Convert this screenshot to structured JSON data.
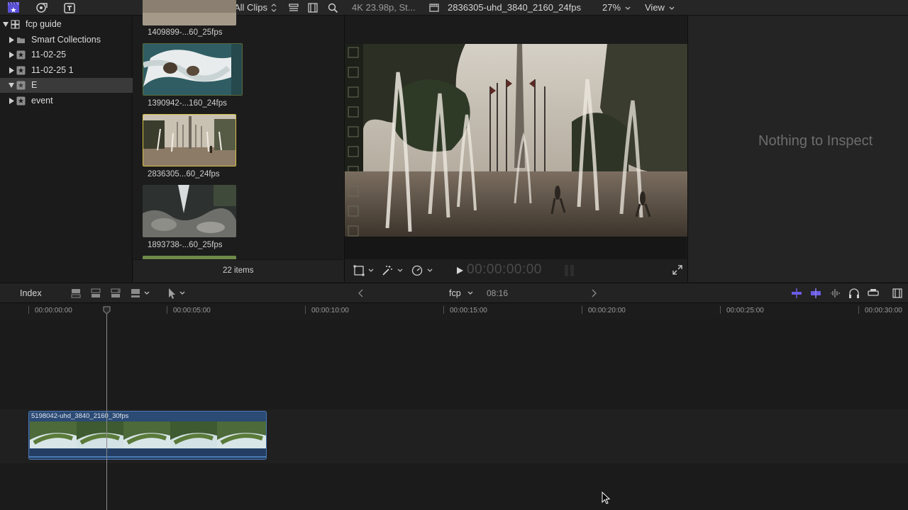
{
  "toolbar": {
    "browser_filter": "All Clips",
    "format_info": "4K 23.98p, St...",
    "clip_title": "2836305-uhd_3840_2160_24fps",
    "zoom": "27%",
    "view_menu": "View"
  },
  "sidebar": {
    "library": "fcp guide",
    "items": [
      {
        "label": "Smart Collections",
        "icon": "folder-icon"
      },
      {
        "label": "11-02-25",
        "icon": "event-star-icon"
      },
      {
        "label": "11-02-25 1",
        "icon": "event-star-icon"
      },
      {
        "label": "E",
        "icon": "event-star-icon",
        "selected": true
      },
      {
        "label": "event",
        "icon": "event-star-icon"
      }
    ]
  },
  "browser": {
    "clips": [
      {
        "name": "1409899-...60_25fps"
      },
      {
        "name": "1390942-...160_24fps"
      },
      {
        "name": "2836305...60_24fps",
        "selected": true
      },
      {
        "name": "1893738-...60_25fps"
      }
    ],
    "item_count": "22 items"
  },
  "viewer": {
    "timecode": "00:00:00:00"
  },
  "inspector": {
    "empty_text": "Nothing to Inspect"
  },
  "timeline": {
    "index_label": "Index",
    "project_name": "fcp",
    "duration": "08:16",
    "ruler": [
      "00:00:00:00",
      "00:00:05:00",
      "00:00:10:00",
      "00:00:15:00",
      "00:00:20:00",
      "00:00:25:00",
      "00:00:30:00"
    ],
    "clip_name": "5198042-uhd_3840_2160_30fps"
  },
  "colors": {
    "accent_purple": "#6b5ce7",
    "clip_blue": "#2b4a74",
    "selection_yellow": "#d6c24a"
  }
}
